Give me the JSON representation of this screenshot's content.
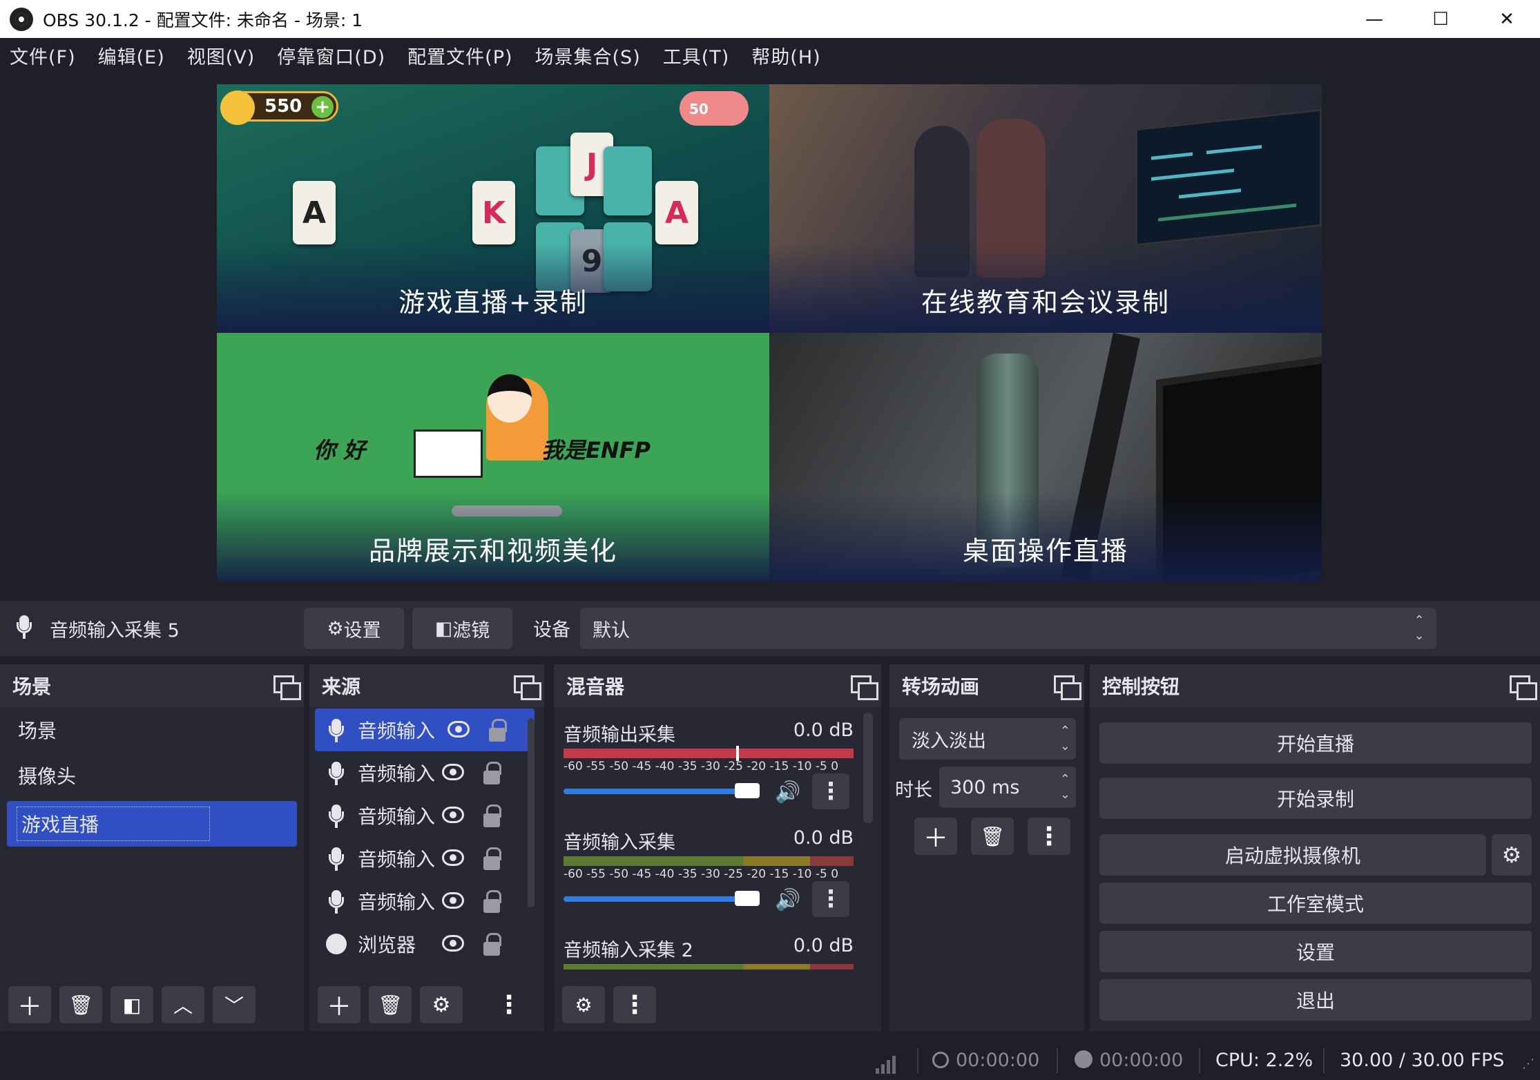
{
  "window": {
    "title": "OBS 30.1.2 - 配置文件: 未命名 - 场景: 1",
    "minimize": "—",
    "maximize": "☐",
    "close": "✕"
  },
  "menu": [
    "文件(F)",
    "编辑(E)",
    "视图(V)",
    "停靠窗口(D)",
    "配置文件(P)",
    "场景集合(S)",
    "工具(T)",
    "帮助(H)"
  ],
  "preview": {
    "tiles": [
      "游戏直播+录制",
      "在线教育和会议录制",
      "品牌展示和视频美化",
      "桌面操作直播"
    ],
    "game_coins": "550",
    "game_piggy": "50",
    "cards": [
      "A",
      "K",
      "J",
      "A",
      "9"
    ],
    "brand_left": "你 好",
    "brand_right": "我是ENFP"
  },
  "source_bar": {
    "name": "音频输入采集 5",
    "settings": "设置",
    "filters": "滤镜",
    "device_label": "设备",
    "device_value": "默认"
  },
  "scenes": {
    "title": "场景",
    "items": [
      "场景",
      "摄像头",
      "游戏直播"
    ],
    "selected": 2
  },
  "sources": {
    "title": "来源",
    "items": [
      {
        "label": "音频输入",
        "type": "mic",
        "selected": true
      },
      {
        "label": "音频输入",
        "type": "mic"
      },
      {
        "label": "音频输入",
        "type": "mic"
      },
      {
        "label": "音频输入",
        "type": "mic"
      },
      {
        "label": "音频输入",
        "type": "mic"
      },
      {
        "label": "浏览器",
        "type": "browser"
      }
    ]
  },
  "mixer": {
    "title": "混音器",
    "tracks": [
      {
        "name": "音频输出采集",
        "db": "0.0 dB",
        "volume": 1.0
      },
      {
        "name": "音频输入采集",
        "db": "0.0 dB",
        "volume": 1.0
      },
      {
        "name": "音频输入采集 2",
        "db": "0.0 dB",
        "volume": 1.0
      }
    ],
    "ticks": "-60 -55 -50 -45 -40 -35 -30 -25 -20 -15 -10  -5   0"
  },
  "transitions": {
    "title": "转场动画",
    "selected": "淡入淡出",
    "duration_label": "时长",
    "duration": "300 ms"
  },
  "controls": {
    "title": "控制按钮",
    "buttons": [
      "开始直播",
      "开始录制",
      "启动虚拟摄像机",
      "工作室模式",
      "设置",
      "退出"
    ]
  },
  "status": {
    "live_time": "00:00:00",
    "rec_time": "00:00:00",
    "cpu": "CPU: 2.2%",
    "fps": "30.00 / 30.00 FPS"
  },
  "colors": {
    "accent": "#2f4fc2",
    "bg": "#1e1f29",
    "panel": "#272834",
    "button": "#3b3c48",
    "meter_hot": "#c23a4a"
  }
}
